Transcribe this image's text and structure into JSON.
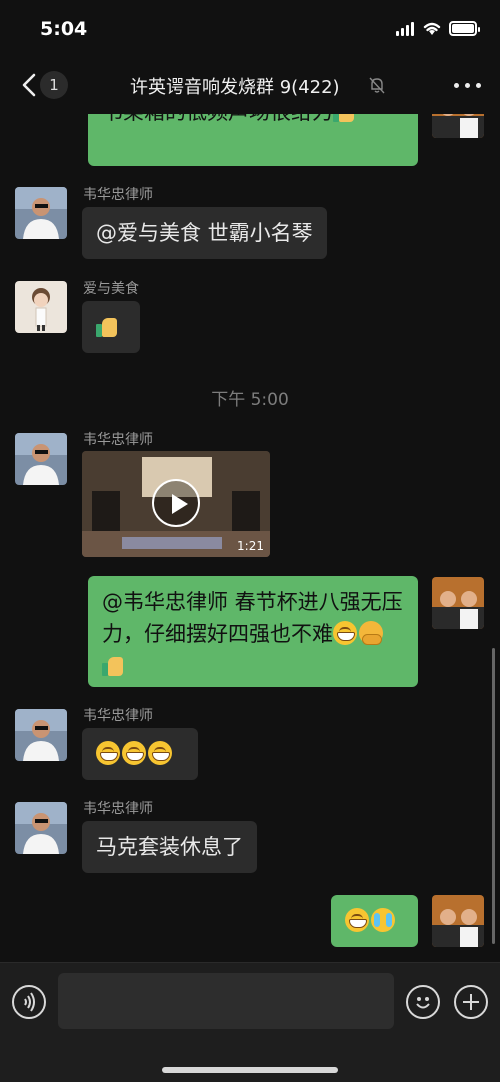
{
  "status_bar": {
    "time": "5:04"
  },
  "nav": {
    "back_count": "1",
    "title": "许英谔音响发烧群 9(422)",
    "mute_icon": "bell-slash-icon",
    "more_icon": "ellipsis-icon"
  },
  "messages": [
    {
      "type": "text",
      "direction": "out",
      "text": "书架箱的低频声场很给力",
      "emojis": [
        "thumbs-up"
      ]
    },
    {
      "type": "text",
      "direction": "in",
      "sender": "韦华忠律师",
      "text": "@爱与美食 世霸小名琴"
    },
    {
      "type": "emoji",
      "direction": "in",
      "sender": "爱与美食",
      "emojis": [
        "thumbs-up"
      ]
    },
    {
      "type": "timestamp",
      "text": "下午 5:00"
    },
    {
      "type": "video",
      "direction": "in",
      "sender": "韦华忠律师",
      "duration": "1:21"
    },
    {
      "type": "text",
      "direction": "out",
      "text": "@韦华忠律师 春节杯进八强无压力，仔细摆好四强也不难",
      "emojis": [
        "grin",
        "hug",
        "thumbs-up"
      ]
    },
    {
      "type": "emoji",
      "direction": "in",
      "sender": "韦华忠律师",
      "emojis": [
        "grin",
        "grin",
        "grin"
      ]
    },
    {
      "type": "text",
      "direction": "in",
      "sender": "韦华忠律师",
      "text": "马克套装休息了"
    },
    {
      "type": "emoji",
      "direction": "out",
      "emojis": [
        "grin",
        "laugh-cry"
      ]
    }
  ],
  "input_bar": {
    "placeholder": ""
  },
  "colors": {
    "background": "#111111",
    "out_bubble": "#5fb769",
    "in_bubble": "#2c2c2c"
  }
}
